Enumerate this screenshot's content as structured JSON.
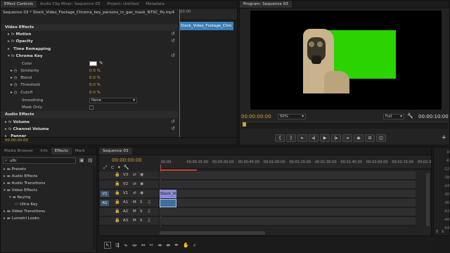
{
  "effect_controls": {
    "tabs": [
      "Effect Controls",
      "Audio Clip Mixer: Sequence 03",
      "Project: Untitled",
      "Metadata"
    ],
    "clip_path": "Sequence 03 * Stock_Video_Footage_Chroma_key_persons_in_gas_mask_NTSC_flv.mp4",
    "mini_timecode": "00:00",
    "clip_label": "Stock_Video_Footage_Chro",
    "video_effects": "Video Effects",
    "motion": "Motion",
    "opacity": "Opacity",
    "time_remapping": "Time Remapping",
    "chroma_key": "Chroma Key",
    "color": "Color",
    "similarity": "Similarity",
    "similarity_val": "0.0 %",
    "blend": "Blend",
    "blend_val": "0.0 %",
    "threshold": "Threshold",
    "threshold_val": "0.0 %",
    "cutoff": "Cutoff",
    "cutoff_val": "0.0 %",
    "smoothing": "Smoothing",
    "smoothing_val": "None",
    "mask_only": "Mask Only",
    "audio_effects": "Audio Effects",
    "volume": "Volume",
    "channel_volume": "Channel Volume",
    "panner": "Panner",
    "bottom_timecode": "00:00:00:00"
  },
  "program": {
    "tab": "Program: Sequence 03",
    "timecode_left": "00:00:00:00",
    "zoom": "50%",
    "quality": "Full",
    "timecode_right": "00:00:10:00",
    "key_color": "#2ad400"
  },
  "media": {
    "tabs": [
      "Media Browser",
      "Info",
      "Effects",
      "Mark"
    ],
    "search_value": "ultr",
    "tree": [
      {
        "label": "Presets",
        "indent": 0
      },
      {
        "label": "Audio Effects",
        "indent": 0
      },
      {
        "label": "Audio Transitions",
        "indent": 0
      },
      {
        "label": "Video Effects",
        "indent": 0
      },
      {
        "label": "Keying",
        "indent": 1
      },
      {
        "label": "Ultra Key",
        "indent": 2
      },
      {
        "label": "Video Transitions",
        "indent": 0
      },
      {
        "label": "Lumetri Looks",
        "indent": 0
      }
    ]
  },
  "timeline": {
    "tab": "Sequence 03",
    "timecode": "00:00:00:00",
    "ruler": [
      "00:00",
      "00:00:15:00",
      "00:00:30:00",
      "00:00:45:00",
      "00:01:00:00",
      "00:01:15:00",
      "00:01:30:00",
      "00:01:45:00",
      "00:02:00:00",
      "00:02:15:00",
      "00:02:3"
    ],
    "tracks": [
      {
        "left": "",
        "name": "V3"
      },
      {
        "left": "",
        "name": "V2"
      },
      {
        "left": "V1",
        "name": "V1"
      },
      {
        "left": "A1",
        "name": "A1"
      },
      {
        "left": "",
        "name": "A2"
      },
      {
        "left": "",
        "name": "A3"
      }
    ],
    "video_clip": "Stock_Vi",
    "mute": "M",
    "solo": "S"
  },
  "meter_labels": [
    "0",
    "-6",
    "-12",
    "-18",
    "-24",
    "-30",
    "-36",
    "-42",
    "-48",
    "-54"
  ],
  "meter_sides": [
    "S",
    "S"
  ]
}
